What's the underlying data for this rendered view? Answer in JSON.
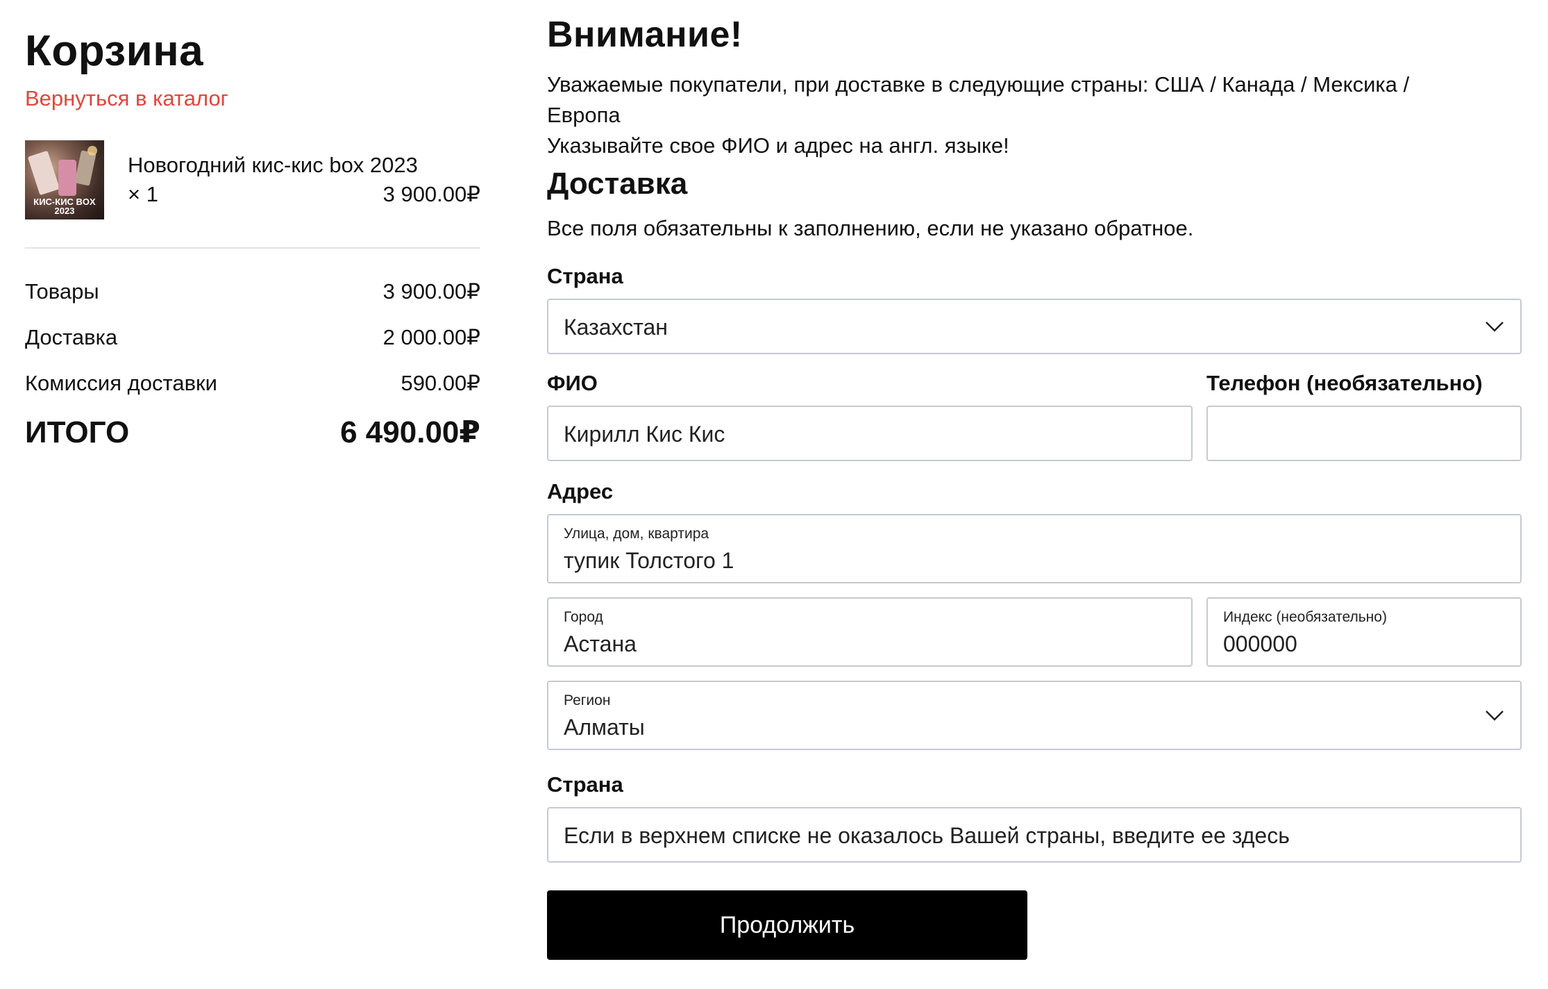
{
  "cart": {
    "title": "Корзина",
    "back_link": "Вернуться в каталог",
    "item": {
      "name": "Новогодний кис-кис box 2023",
      "quantity": "× 1",
      "price": "3 900.00₽",
      "image_text": "КИС-КИС BOX 2023"
    },
    "summary": [
      {
        "label": "Товары",
        "value": "3 900.00₽"
      },
      {
        "label": "Доставка",
        "value": "2 000.00₽"
      },
      {
        "label": "Комиссия доставки",
        "value": "590.00₽"
      }
    ],
    "total": {
      "label": "ИТОГО",
      "value": "6 490.00₽"
    }
  },
  "form": {
    "attention_title": "Внимание!",
    "notice_line1": "Уважаемые покупатели, при доставке в следующие страны: США / Канада / Мексика /",
    "notice_line2": "Европа",
    "notice_line3": "Указывайте свое ФИО и адрес на англ. языке!",
    "delivery_title": "Доставка",
    "required_note": "Все поля обязательны к заполнению, если не указано обратное.",
    "country_label": "Страна",
    "country_value": "Казахстан",
    "name_label": "ФИО",
    "name_value": "Кирилл Кис Кис",
    "phone_label": "Телефон (необязательно)",
    "phone_value": "",
    "address_label": "Адрес",
    "street_label": "Улица, дом, квартира",
    "street_value": "тупик Толстого 1",
    "city_label": "Город",
    "city_value": "Астана",
    "zip_label": "Индекс (необязательно)",
    "zip_value": "000000",
    "region_label": "Регион",
    "region_value": "Алматы",
    "other_country_label": "Страна",
    "other_country_placeholder": "Если в верхнем списке не оказалось Вашей страны, введите ее здесь",
    "continue_button": "Продолжить"
  }
}
